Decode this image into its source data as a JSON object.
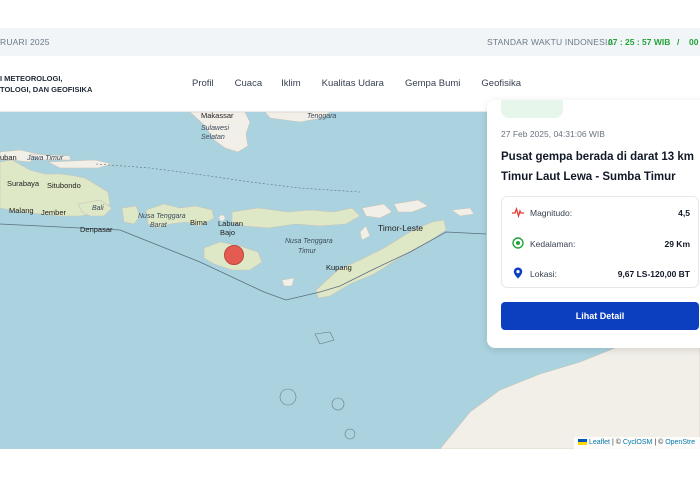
{
  "topbar": {
    "date_text": "RUARI 2025",
    "standard_time_label": "STANDAR WAKTU INDONESIA",
    "time_wib": "07 : 25 : 57 WIB",
    "separator": "/",
    "time_next": "00"
  },
  "header": {
    "brand_line1": "I METEOROLOGI,",
    "brand_line2": "TOLOGI, DAN GEOFISIKA",
    "nav": [
      "Profil",
      "Cuaca",
      "Iklim",
      "Kualitas Udara",
      "Gempa Bumi",
      "Geofisika"
    ]
  },
  "map": {
    "labels": {
      "makassar": "Makassar",
      "sulawesi_selatan_1": "Sulawesi",
      "sulawesi_selatan_2": "Selatan",
      "tenggara": "Tenggara",
      "uban": "uban",
      "jawa_timur": "Jawa Timur",
      "surabaya": "Surabaya",
      "situbondo": "Situbondo",
      "malang": "Malang",
      "jember": "Jember",
      "bali": "Bali",
      "denpasar": "Denpasar",
      "ntb_1": "Nusa Tenggara",
      "ntb_2": "Barat",
      "bima": "Bima",
      "labuan_1": "Labuan",
      "labuan_2": "Bajo",
      "ntt_1": "Nusa Tenggara",
      "ntt_2": "Timur",
      "timor_leste": "Timor-Leste",
      "kupang": "Kupang"
    },
    "attribution": {
      "leaflet": "Leaflet",
      "sep1": "| ©",
      "cyclosm": "CyclOSM",
      "sep2": "| ©",
      "openstreet": "OpenStre"
    },
    "colors": {
      "sea": "#aad3df",
      "land": "#f2efe9",
      "epicenter": "#e53935"
    }
  },
  "card": {
    "datetime": "27 Feb 2025, 04:31:06 WIB",
    "title": "Pusat gempa berada di darat 13 km Timur Laut Lewa - Sumba Timur",
    "rows": [
      {
        "label": "Magnitudo:",
        "value": "4,5",
        "icon": "pulse-icon"
      },
      {
        "label": "Kedalaman:",
        "value": "29 Km",
        "icon": "depth-target-icon"
      },
      {
        "label": "Lokasi:",
        "value": "9,67 LS-120,00 BT",
        "icon": "location-pin-icon"
      }
    ],
    "button_label": "Lihat Detail"
  }
}
